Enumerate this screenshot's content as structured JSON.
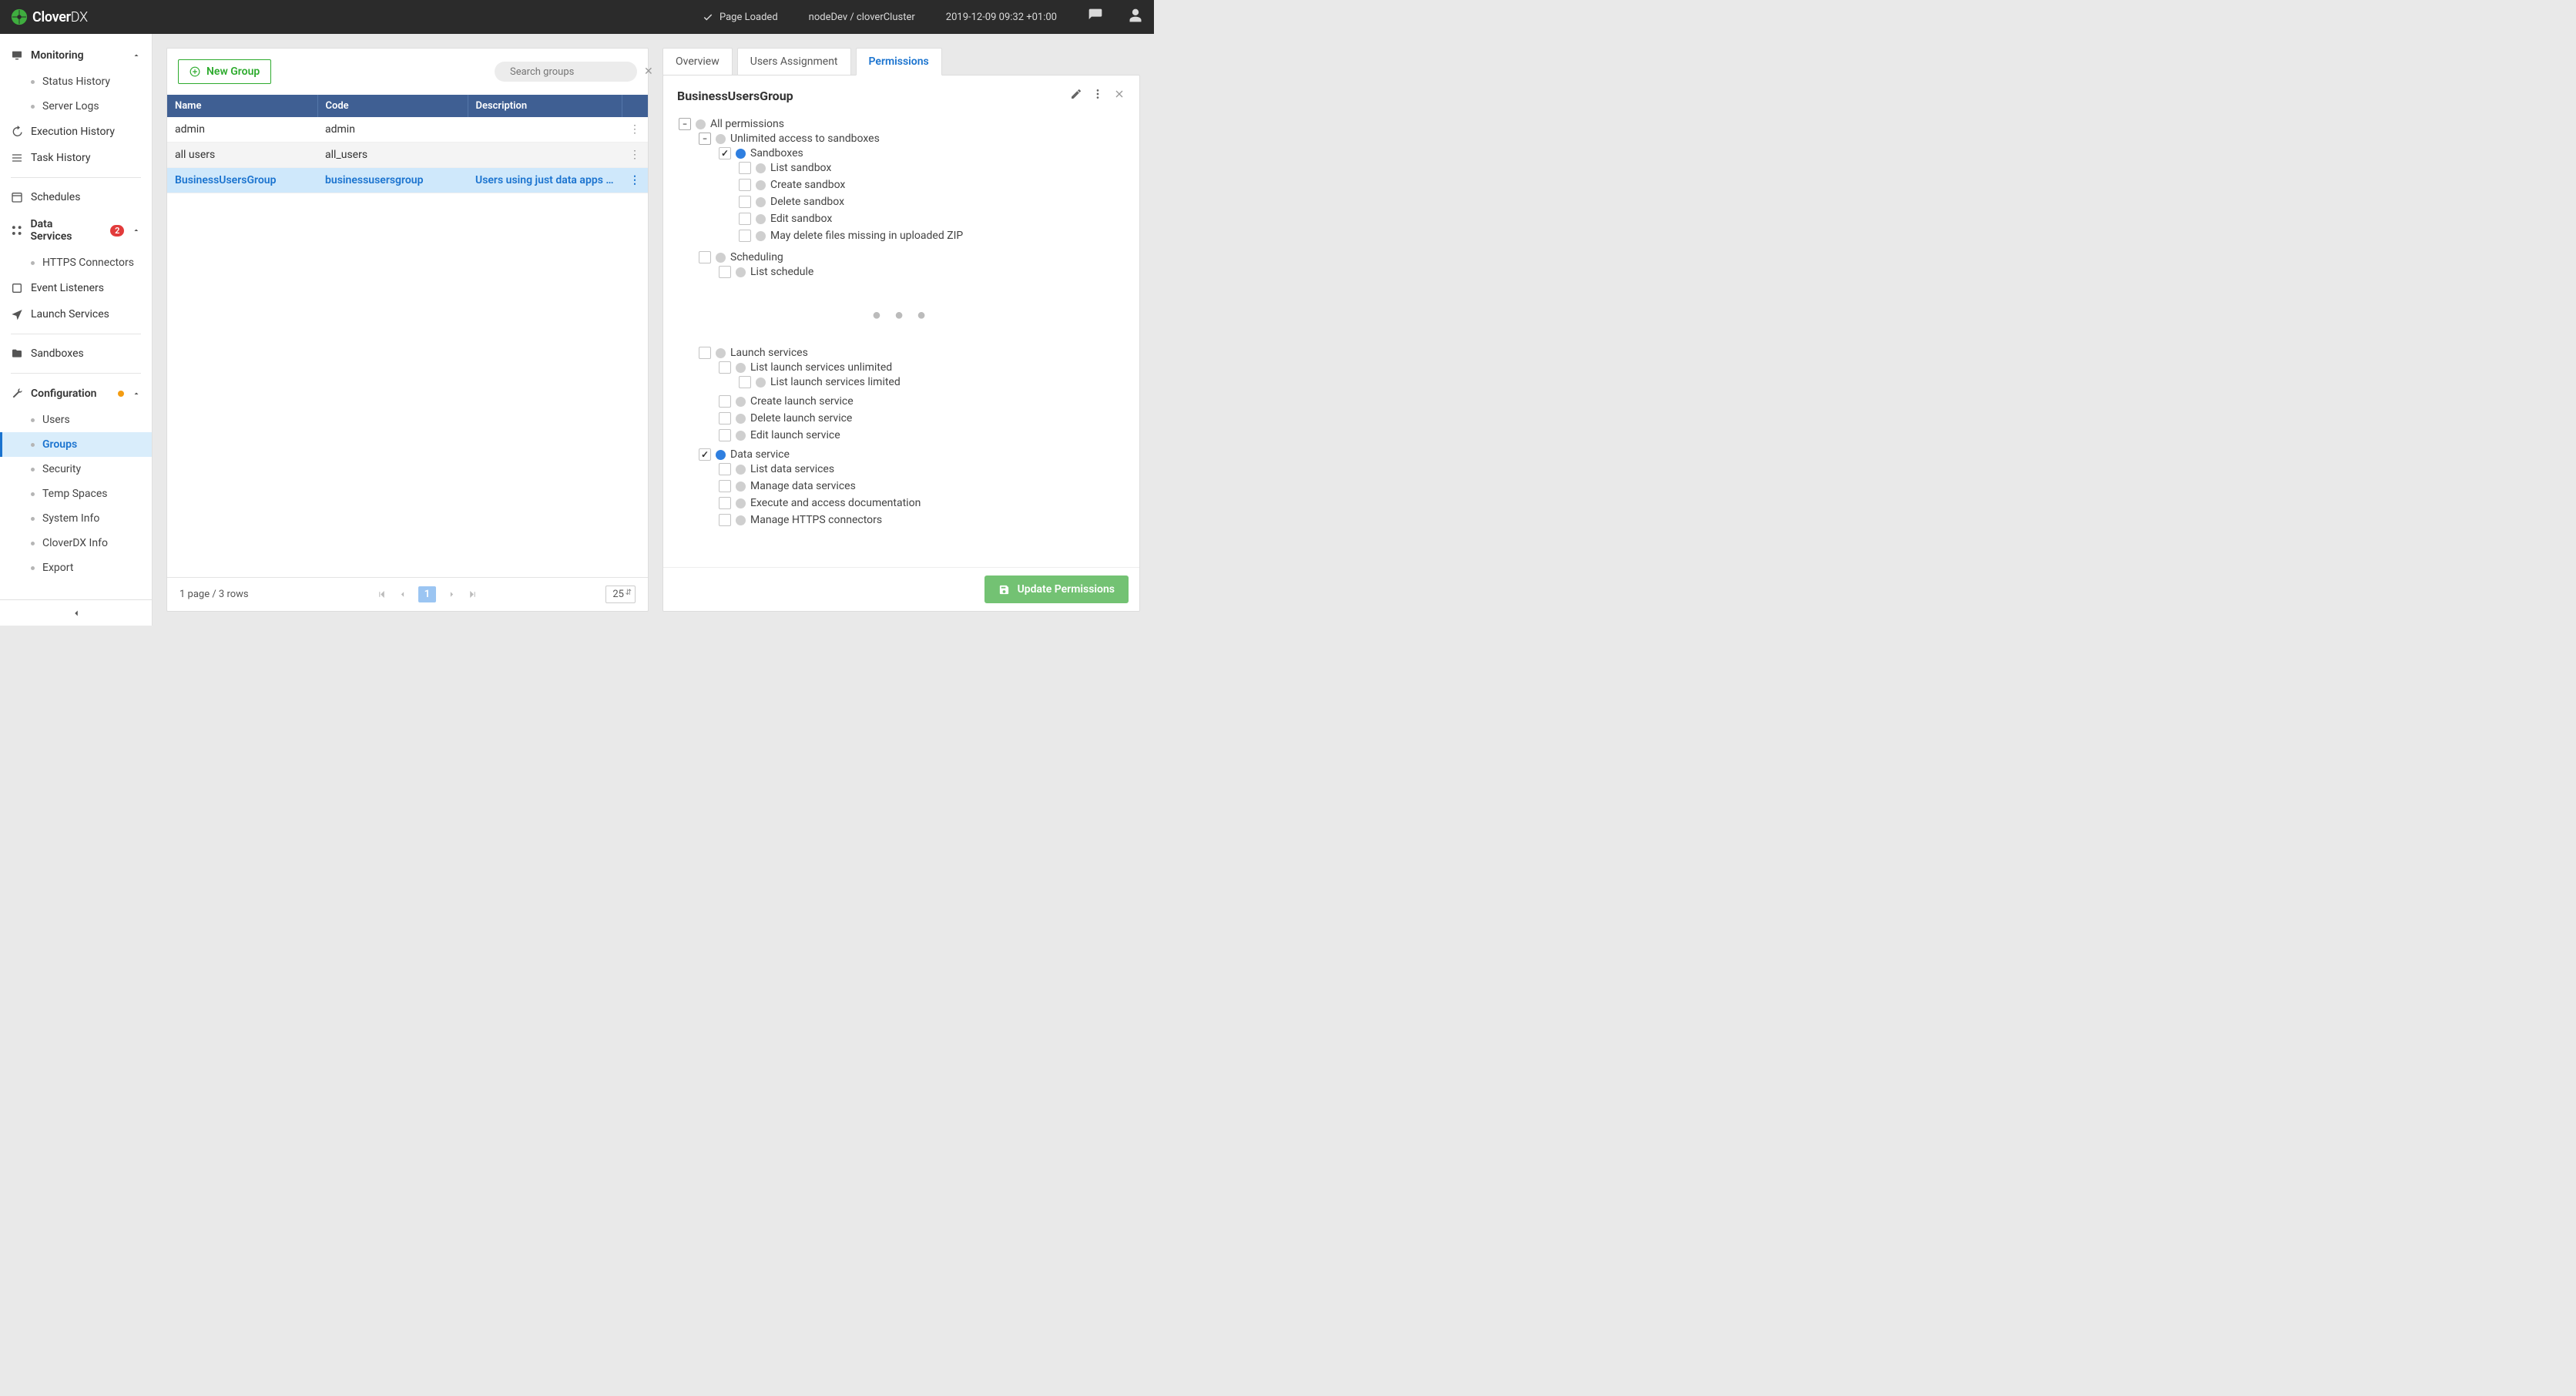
{
  "topbar": {
    "brand_first": "Clover",
    "brand_second": "DX",
    "status_label": "Page Loaded",
    "node_label": "nodeDev / cloverCluster",
    "timestamp": "2019-12-09 09:32 +01:00"
  },
  "sidebar": {
    "monitoring": {
      "label": "Monitoring",
      "items": [
        "Status History",
        "Server Logs"
      ]
    },
    "execHistory": "Execution History",
    "taskHistory": "Task History",
    "schedules": "Schedules",
    "dataServices": {
      "label": "Data Services",
      "badge": "2",
      "items": [
        "HTTPS Connectors"
      ]
    },
    "eventListeners": "Event Listeners",
    "launchServices": "Launch Services",
    "sandboxes": "Sandboxes",
    "configuration": {
      "label": "Configuration",
      "items": [
        "Users",
        "Groups",
        "Security",
        "Temp Spaces",
        "System Info",
        "CloverDX Info",
        "Export"
      ]
    }
  },
  "groups": {
    "newGroupBtn": "New Group",
    "searchPlaceholder": "Search groups",
    "columns": {
      "name": "Name",
      "code": "Code",
      "desc": "Description"
    },
    "rows": [
      {
        "name": "admin",
        "code": "admin",
        "desc": ""
      },
      {
        "name": "all users",
        "code": "all_users",
        "desc": ""
      },
      {
        "name": "BusinessUsersGroup",
        "code": "businessusersgroup",
        "desc": "Users using just data apps wi..."
      }
    ],
    "footer": {
      "summary": "1 page / 3 rows",
      "currentPage": "1",
      "pageSize": "25"
    }
  },
  "detail": {
    "tabs": {
      "overview": "Overview",
      "users": "Users Assignment",
      "permissions": "Permissions"
    },
    "title": "BusinessUsersGroup",
    "perm": {
      "all": "All permissions",
      "unlimited": "Unlimited access to sandboxes",
      "sandboxes": "Sandboxes",
      "listSandbox": "List sandbox",
      "createSandbox": "Create sandbox",
      "deleteSandbox": "Delete sandbox",
      "editSandbox": "Edit sandbox",
      "mayDelete": "May delete files missing in uploaded ZIP",
      "scheduling": "Scheduling",
      "listSchedule": "List schedule",
      "launchServices": "Launch services",
      "listLaunchUnlimited": "List launch services unlimited",
      "listLaunchLimited": "List launch services limited",
      "createLaunch": "Create launch service",
      "deleteLaunch": "Delete launch service",
      "editLaunch": "Edit launch service",
      "dataService": "Data service",
      "listDataServices": "List data services",
      "manageDataServices": "Manage data services",
      "executeDoc": "Execute and access documentation",
      "manageHttps": "Manage HTTPS connectors"
    },
    "updateBtn": "Update Permissions"
  }
}
